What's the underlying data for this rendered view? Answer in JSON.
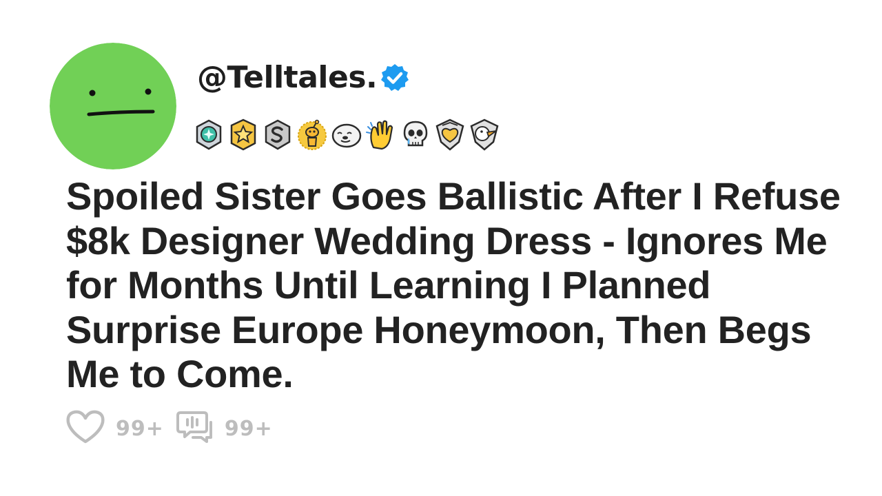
{
  "post": {
    "username": "@Telltales.",
    "title": "Spoiled Sister Goes Ballistic After I Refuse $8k Designer Wedding Dress - Ignores Me for Months Until Learning I Planned Surprise Europe Honeymoon, Then Begs Me to Come.",
    "likes_count": "99+",
    "comments_count": "99+"
  },
  "awards": [
    "silver-gem-award-icon",
    "gold-star-award-icon",
    "silver-s-award-icon",
    "gold-snoo-award-icon",
    "seal-award-icon",
    "clapping-hands-award-icon",
    "crying-skull-award-icon",
    "gold-heart-badge-award-icon",
    "bird-badge-award-icon"
  ],
  "colors": {
    "avatar": "#71d056",
    "verified": "#1d9bf0",
    "text": "#222222",
    "muted": "#bdbdbd"
  }
}
